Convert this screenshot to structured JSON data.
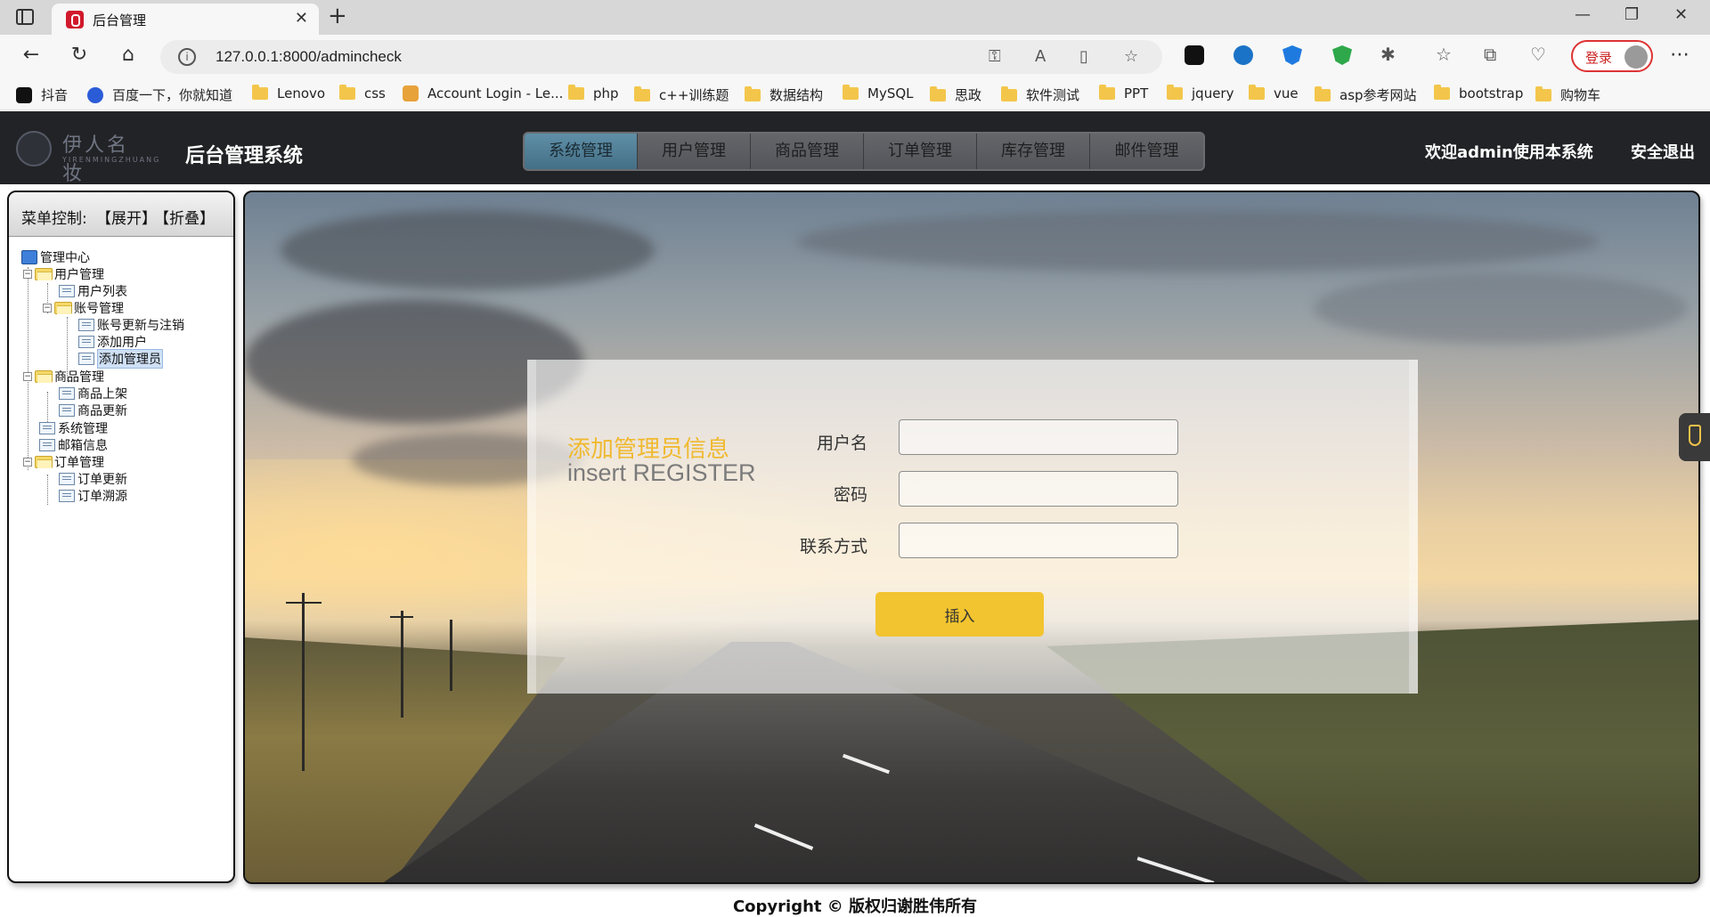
{
  "browser": {
    "tab_title": "后台管理",
    "url": "127.0.0.1:8000/admincheck",
    "login_label": "登录",
    "bookmarks": [
      "抖音",
      "百度一下，你就知道",
      "Lenovo",
      "css",
      "Account Login - Le...",
      "php",
      "c++训练题",
      "数据结构",
      "MySQL",
      "思政",
      "软件测试",
      "PPT",
      "jquery",
      "vue",
      "asp参考网站",
      "bootstrap",
      "购物车"
    ]
  },
  "header": {
    "logo_cn": "伊人名妆",
    "logo_en": "YIRENMINGZHUANG",
    "title": "后台管理系统",
    "nav": [
      "系统管理",
      "用户管理",
      "商品管理",
      "订单管理",
      "库存管理",
      "邮件管理"
    ],
    "active_nav": "系统管理",
    "welcome": "欢迎admin使用本系统",
    "logout": "安全退出"
  },
  "sidebar": {
    "control_label": "菜单控制:",
    "expand": "【展开】",
    "collapse": "【折叠】",
    "tree": [
      "管理中心",
      "用户管理",
      "用户列表",
      "账号管理",
      "账号更新与注销",
      "添加用户",
      "添加管理员",
      "商品管理",
      "商品上架",
      "商品更新",
      "系统管理",
      "邮箱信息",
      "订单管理",
      "订单更新",
      "订单溯源"
    ],
    "selected": "添加管理员"
  },
  "form": {
    "title": "添加管理员信息",
    "subtitle": "insert REGISTER",
    "fields": [
      {
        "label": "用户名",
        "value": ""
      },
      {
        "label": "密码",
        "value": ""
      },
      {
        "label": "联系方式",
        "value": ""
      }
    ],
    "submit": "插入"
  },
  "footer": "Copyright © 版权归谢胜伟所有",
  "colors": {
    "header_bg": "#222326",
    "nav_active": "#4f7f97",
    "accent_yellow": "#f2c42f",
    "login_red": "#cc2222"
  }
}
